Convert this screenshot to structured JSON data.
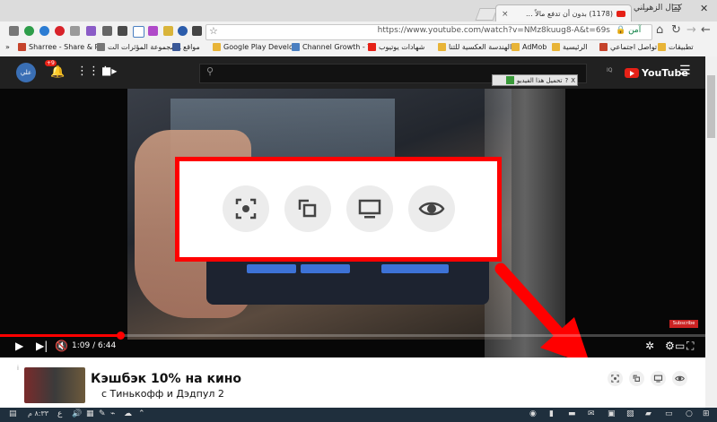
{
  "browser": {
    "tab_title": "(1178) بدون أن تدفع مالاً ...",
    "tab_close": "×",
    "profile_name": "كمال الزهراني",
    "window_buttons": [
      "—",
      "☐",
      "✕"
    ],
    "url": "https://www.youtube.com/watch?v=NMz8kuug8-A&t=69s",
    "secure_label": "آمن",
    "bookmarks": [
      {
        "label": "Sharree - Share & P",
        "color": "#c5432b"
      },
      {
        "label": "مجموعة المؤثرات الت...",
        "color": "#777777"
      },
      {
        "label": "مواقع",
        "color": "#e8b437"
      },
      {
        "label": "Google Play Develop",
        "color": "#3b5998"
      },
      {
        "label": "Channel Growth - Yo",
        "color": "#4a7fc1"
      },
      {
        "label": "شهادات يوتيوب",
        "color": "#e62117"
      },
      {
        "label": "الهندسة العكسية للتنا",
        "color": "#e8b437"
      },
      {
        "label": "AdMob",
        "color": "#e8b437"
      },
      {
        "label": "الرئيسية",
        "color": "#e8b437"
      },
      {
        "label": "تواصل اجتماعي",
        "color": "#c5432b"
      },
      {
        "label": "تطبيقات",
        "color": "#e8b437"
      }
    ],
    "bookmarks_more": "»"
  },
  "youtube": {
    "avatar_text": "علي",
    "notification_count": "+9",
    "logo_text": "YouTube",
    "country_code": "IQ",
    "download_bar_text": "تحميل هذا الفيديو"
  },
  "player": {
    "current_time": "1:09 / 6:44",
    "progress_fraction": 0.171,
    "watermark": "Subscribe"
  },
  "ad": {
    "info_icon": "i",
    "title": "Кэшбэк 10% на кино",
    "subtitle": "с Тинькофф и Дэдпул 2"
  },
  "taskbar": {
    "time": "٨:٣٣ م",
    "lang": "ع"
  },
  "colors": {
    "highlight_red": "#ff0000",
    "youtube_red": "#e62117"
  }
}
